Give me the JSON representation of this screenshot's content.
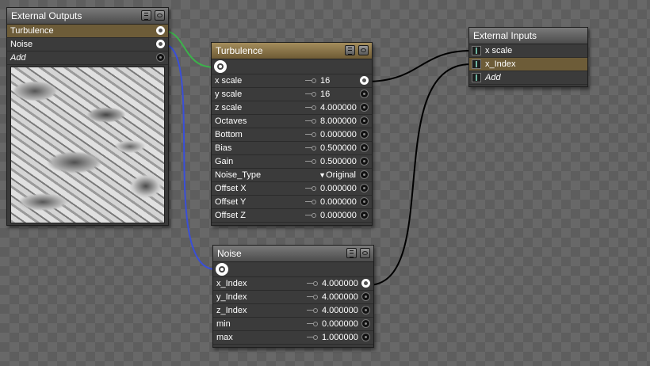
{
  "colors": {
    "wire_green": "#3bb34a",
    "wire_blue": "#3a4fd8",
    "wire_black": "#000000",
    "header_gold": "#8a7546",
    "row_selected": "#6d5c38"
  },
  "external_outputs": {
    "title": "External Outputs",
    "rows": [
      {
        "label": "Turbulence"
      },
      {
        "label": "Noise"
      },
      {
        "label": "Add"
      }
    ],
    "preview_icon": "marble-noise-preview"
  },
  "turbulence": {
    "title": "Turbulence",
    "params": [
      {
        "label": "x scale",
        "value": "16"
      },
      {
        "label": "y scale",
        "value": "16"
      },
      {
        "label": "z scale",
        "value": "4.000000"
      },
      {
        "label": "Octaves",
        "value": "8.000000"
      },
      {
        "label": "Bottom",
        "value": "0.000000"
      },
      {
        "label": "Bias",
        "value": "0.500000"
      },
      {
        "label": "Gain",
        "value": "0.500000"
      },
      {
        "label": "Noise_Type",
        "value": "Original"
      },
      {
        "label": "Offset X",
        "value": "0.000000"
      },
      {
        "label": "Offset Y",
        "value": "0.000000"
      },
      {
        "label": "Offset Z",
        "value": "0.000000"
      }
    ]
  },
  "external_inputs": {
    "title": "External Inputs",
    "rows": [
      {
        "label": "x scale"
      },
      {
        "label": "x_Index"
      },
      {
        "label": "Add"
      }
    ]
  },
  "noise": {
    "title": "Noise",
    "params": [
      {
        "label": "x_Index",
        "value": "4.000000"
      },
      {
        "label": "y_Index",
        "value": "4.000000"
      },
      {
        "label": "z_Index",
        "value": "4.000000"
      },
      {
        "label": "min",
        "value": "0.000000"
      },
      {
        "label": "max",
        "value": "1.000000"
      }
    ]
  }
}
